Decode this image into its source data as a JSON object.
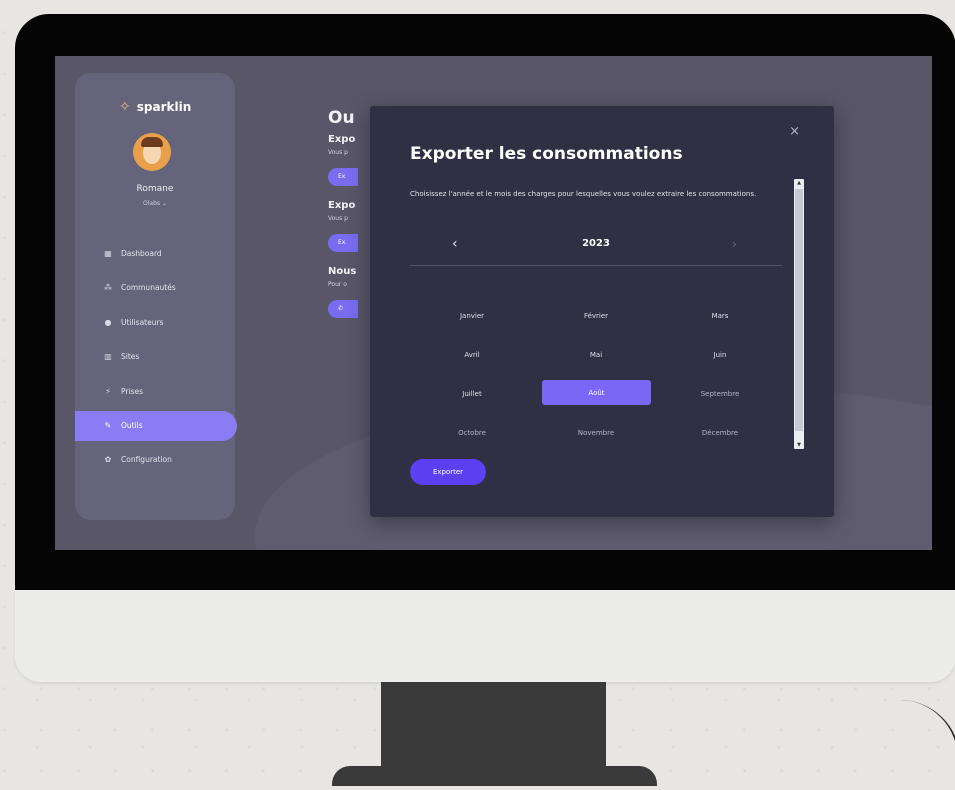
{
  "app": {
    "brand": "sparklin",
    "logo_icon": "sparkle-icon"
  },
  "user": {
    "name": "Romane",
    "organization": "Olabs"
  },
  "nav": {
    "items": [
      {
        "label": "Dashboard",
        "icon": "grid-icon"
      },
      {
        "label": "Communautés",
        "icon": "community-icon"
      },
      {
        "label": "Utilisateurs",
        "icon": "user-icon"
      },
      {
        "label": "Sites",
        "icon": "building-icon"
      },
      {
        "label": "Prises",
        "icon": "plug-icon"
      },
      {
        "label": "Outils",
        "icon": "wrench-icon",
        "active": true
      },
      {
        "label": "Configuration",
        "icon": "gear-icon"
      }
    ]
  },
  "page": {
    "title": "Ou",
    "section1_heading": "Expo",
    "section1_text": "Vous p",
    "section1_button": "Ex",
    "section2_heading": "Expo",
    "section2_text": "Vous p",
    "section2_button": "Ex",
    "section3_heading": "Nous",
    "section3_text": "Pour o"
  },
  "modal": {
    "title": "Exporter les consommations",
    "description": "Choisissez l'année et le mois des charges pour lesquelles vous voulez extraire les consommations.",
    "year": "2023",
    "prev_symbol": "‹",
    "next_symbol": "›",
    "close_symbol": "×",
    "months": [
      "Janvier",
      "Février",
      "Mars",
      "Avril",
      "Mai",
      "Juin",
      "Juillet",
      "Août",
      "Septembre",
      "Octobre",
      "Novembre",
      "Décembre"
    ],
    "selected_month": "Août",
    "export_label": "Exporter"
  },
  "colors": {
    "accent": "#7b66f5",
    "button": "#5b3ff0",
    "modal_bg": "#302f43",
    "sidebar_bg": "#66647a"
  }
}
